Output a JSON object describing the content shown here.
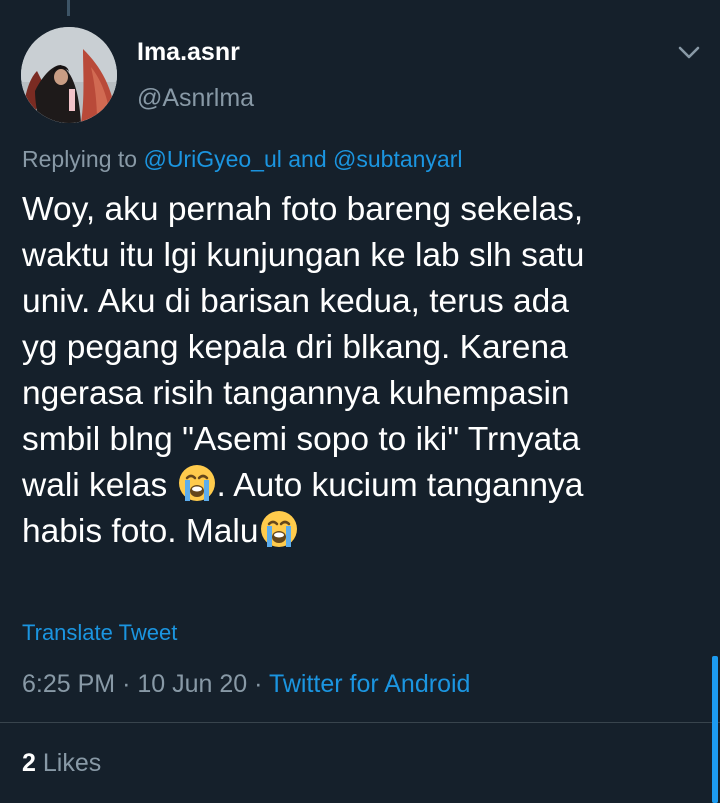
{
  "tweet": {
    "author": {
      "display_name": "Ima.asnr",
      "handle": "@Asnrlma",
      "avatar_icon": "avatar-photo"
    },
    "reply_context": {
      "prefix": "Replying to",
      "mention_1": "@UriGyeo_ul",
      "conjunction": "and",
      "mention_2": "@subtanyarl"
    },
    "text_lines": [
      "Woy, aku pernah foto bareng sekelas,",
      "waktu itu lgi kunjungan ke lab slh satu",
      "univ. Aku di barisan kedua, terus ada",
      "yg pegang kepala dri blkang. Karena",
      "ngerasa risih tangannya kuhempasin",
      "smbil blng \"Asemi sopo to iki\" Trnyata",
      "wali kelas ",
      ". Auto kucium tangannya",
      "habis foto. Malu"
    ],
    "emoji": "loudly-crying-face",
    "translate_label": "Translate Tweet",
    "time": "6:25 PM",
    "date": "10 Jun 20",
    "separator": "·",
    "source": "Twitter for Android",
    "likes_count": "2",
    "likes_label": "Likes"
  },
  "colors": {
    "background": "#15202b",
    "primary_text": "#ffffff",
    "secondary_text": "#8899a6",
    "accent": "#1b95e0",
    "divider": "#38444d"
  },
  "icons": {
    "more": "chevron-down-icon",
    "emoji": "loudly-crying-face-icon"
  }
}
